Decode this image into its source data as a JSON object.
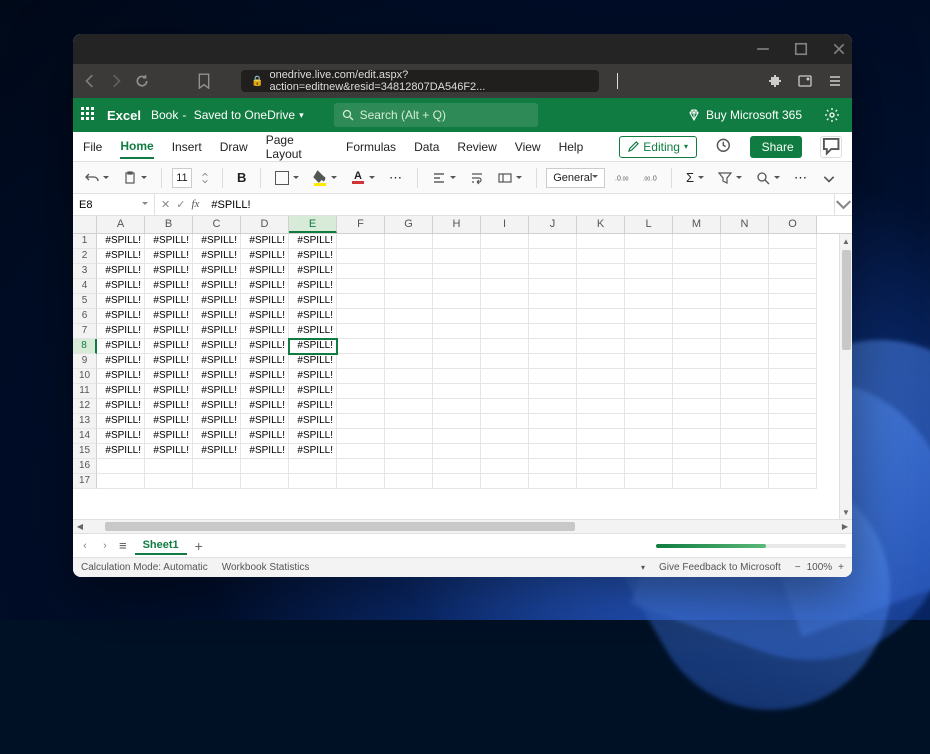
{
  "browser": {
    "url": "onedrive.live.com/edit.aspx?action=editnew&resid=34812807DA546F2..."
  },
  "header": {
    "app_name": "Excel",
    "doc_name": "Book",
    "saved_text": "Saved to OneDrive",
    "search_placeholder": "Search (Alt + Q)",
    "buy_label": "Buy Microsoft 365"
  },
  "tabs": {
    "items": [
      "File",
      "Home",
      "Insert",
      "Draw",
      "Page Layout",
      "Formulas",
      "Data",
      "Review",
      "View",
      "Help"
    ],
    "active_index": 1,
    "editing_label": "Editing",
    "share_label": "Share"
  },
  "ribbon": {
    "font_size": "11",
    "number_format": "General"
  },
  "formula_bar": {
    "name_box": "E8",
    "value": "#SPILL!"
  },
  "grid": {
    "columns": [
      "A",
      "B",
      "C",
      "D",
      "E",
      "F",
      "G",
      "H",
      "I",
      "J",
      "K",
      "L",
      "M",
      "N",
      "O"
    ],
    "row_count": 17,
    "error": "#SPILL!",
    "filled_cols": 4,
    "filled_rows": 15,
    "partial_col_index": 4,
    "partial_col_row_limits": [
      8,
      7
    ],
    "selected": {
      "row": 8,
      "col": "E",
      "col_index": 4
    }
  },
  "sheettabs": {
    "sheet_name": "Sheet1"
  },
  "statusbar": {
    "calc_mode": "Calculation Mode: Automatic",
    "stats": "Workbook Statistics",
    "feedback": "Give Feedback to Microsoft",
    "zoom": "100%"
  }
}
